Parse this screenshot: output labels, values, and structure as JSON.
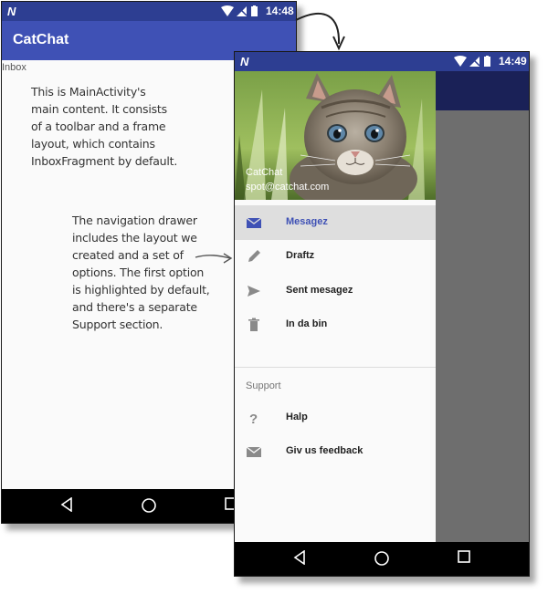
{
  "phone_back": {
    "status_bar": {
      "time": "14:48"
    },
    "toolbar": {
      "title": "CatChat"
    },
    "content": {
      "fragment_label": "Inbox"
    },
    "nav_bar": {
      "back": "back-icon",
      "home": "home-icon",
      "recents": "recents-icon"
    }
  },
  "phone_front": {
    "status_bar": {
      "time": "14:49"
    },
    "drawer": {
      "header": {
        "name": "CatChat",
        "email": "spot@catchat.com"
      },
      "items": [
        {
          "label": "Mesagez",
          "icon": "mail-icon",
          "selected": true
        },
        {
          "label": "Draftz",
          "icon": "pencil-icon",
          "selected": false
        },
        {
          "label": "Sent mesagez",
          "icon": "send-icon",
          "selected": false
        },
        {
          "label": "In da bin",
          "icon": "trash-icon",
          "selected": false
        }
      ],
      "support_section": {
        "title": "Support",
        "items": [
          {
            "label": "Halp",
            "icon": "help-icon"
          },
          {
            "label": "Giv us feedback",
            "icon": "mail-icon"
          }
        ]
      }
    },
    "nav_bar": {
      "back": "back-icon",
      "home": "home-icon",
      "recents": "recents-icon"
    }
  },
  "annotations": {
    "main_content": [
      "This is MainActivity's",
      "main content. It consists",
      "of a toolbar and a frame",
      "layout, which contains",
      "InboxFragment by default."
    ],
    "drawer": [
      "The navigation drawer",
      "includes the layout we",
      "created and a set of",
      "options. The first option",
      "is highlighted by default,",
      "and there's a separate",
      "Support section."
    ]
  },
  "colors": {
    "primary": "#3f51b5",
    "primary_dark": "#2d3e92",
    "selected_row": "#dedede",
    "scrim": "#6e6e6e"
  }
}
